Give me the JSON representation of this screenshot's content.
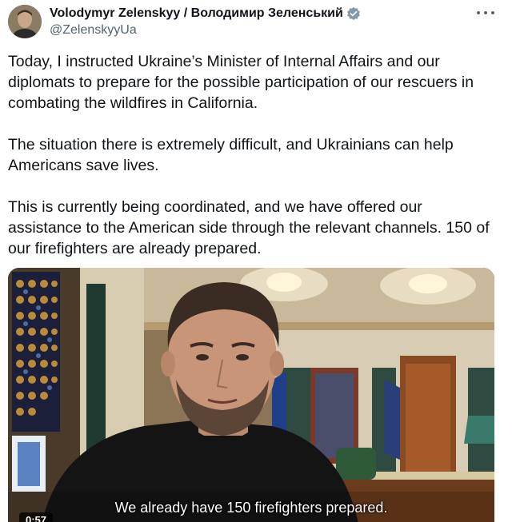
{
  "author": {
    "display_name": "Volodymyr Zelenskyy / Володимир Зеленський",
    "handle": "@ZelenskyyUa",
    "verified": true
  },
  "icons": {
    "verified": "verified-badge-icon",
    "more": "more-options-icon"
  },
  "colors": {
    "verified_badge": "#829aab",
    "text": "#0f1419",
    "secondary_text": "#536471"
  },
  "tweet": {
    "paragraphs": [
      "Today, I instructed Ukraine’s Minister of Internal Affairs and our diplomats to prepare for the possible participation of our rescuers in combating the wildfires in California.",
      "The situation there is extremely difficult, and Ukrainians can help Americans save lives.",
      "This is currently being coordinated, and we have offered our assistance to the American side through the relevant channels. 150 of our firefighters are already prepared."
    ]
  },
  "video": {
    "subtitle": "We already have 150 firefighters prepared.",
    "timestamp": "0:57"
  }
}
